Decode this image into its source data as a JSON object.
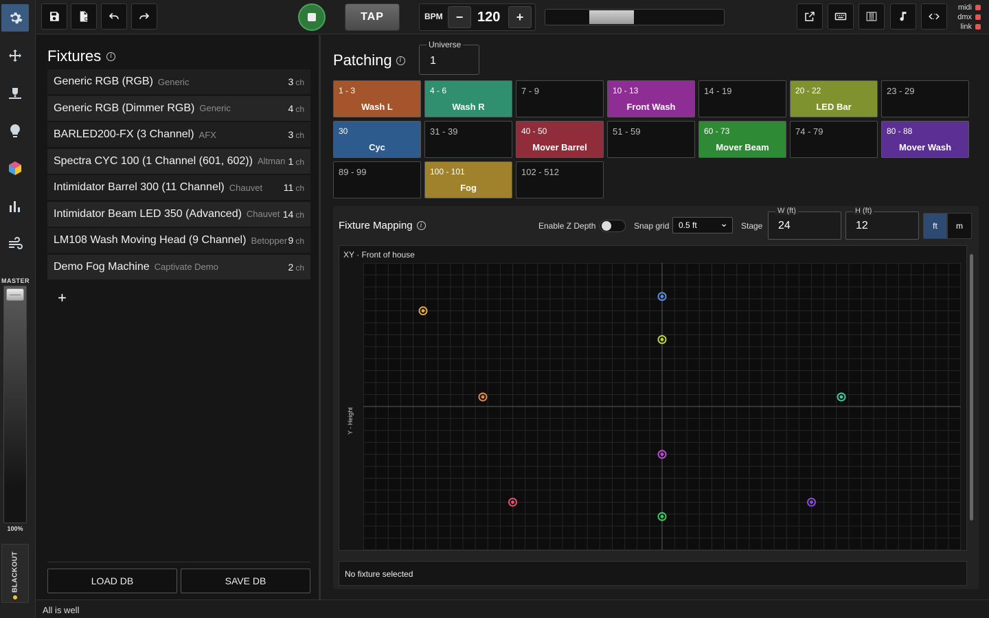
{
  "toolbar": {
    "bpm_label": "BPM",
    "bpm_value": "120",
    "bpm_minus": "−",
    "bpm_plus": "+",
    "tap_label": "TAP",
    "status_lights": [
      {
        "label": "midi",
        "color": "#e05555"
      },
      {
        "label": "dmx",
        "color": "#e05555"
      },
      {
        "label": "link",
        "color": "#e05555"
      }
    ]
  },
  "master": {
    "label": "MASTER",
    "value": "100%",
    "level": 1.0
  },
  "blackout": {
    "label": "BLACKOUT"
  },
  "fixtures": {
    "title": "Fixtures",
    "items": [
      {
        "name": "Generic RGB (RGB)",
        "maker": "Generic",
        "channels": "3",
        "unit": "ch"
      },
      {
        "name": "Generic RGB (Dimmer RGB)",
        "maker": "Generic",
        "channels": "4",
        "unit": "ch"
      },
      {
        "name": "BARLED200-FX (3 Channel)",
        "maker": "AFX",
        "channels": "3",
        "unit": "ch"
      },
      {
        "name": "Spectra CYC 100 (1 Channel (601, 602))",
        "maker": "Altman",
        "channels": "1",
        "unit": "ch"
      },
      {
        "name": "Intimidator Barrel 300 (11 Channel)",
        "maker": "Chauvet",
        "channels": "11",
        "unit": "ch"
      },
      {
        "name": "Intimidator Beam LED 350 (Advanced)",
        "maker": "Chauvet",
        "channels": "14",
        "unit": "ch"
      },
      {
        "name": "LM108 Wash Moving Head (9 Channel)",
        "maker": "Betopper",
        "channels": "9",
        "unit": "ch"
      },
      {
        "name": "Demo Fog Machine",
        "maker": "Captivate Demo",
        "channels": "2",
        "unit": "ch"
      }
    ],
    "add_label": "+",
    "load_db": "LOAD DB",
    "save_db": "SAVE DB"
  },
  "patching": {
    "title": "Patching",
    "universe_label": "Universe",
    "universe_value": "1",
    "tiles": [
      {
        "range": "1 - 3",
        "name": "Wash L",
        "color": "#a4552c"
      },
      {
        "range": "4 - 6",
        "name": "Wash R",
        "color": "#2f8f6e"
      },
      {
        "range": "7 - 9",
        "name": "",
        "color": ""
      },
      {
        "range": "10 - 13",
        "name": "Front Wash",
        "color": "#8e2e94"
      },
      {
        "range": "14 - 19",
        "name": "",
        "color": ""
      },
      {
        "range": "20 - 22",
        "name": "LED Bar",
        "color": "#7e9230"
      },
      {
        "range": "23 - 29",
        "name": "",
        "color": ""
      },
      {
        "range": "30",
        "name": "Cyc",
        "color": "#2e5b8e"
      },
      {
        "range": "31 - 39",
        "name": "",
        "color": ""
      },
      {
        "range": "40 - 50",
        "name": "Mover Barrel",
        "color": "#912c3a"
      },
      {
        "range": "51 - 59",
        "name": "",
        "color": ""
      },
      {
        "range": "60 - 73",
        "name": "Mover Beam",
        "color": "#2f8a35"
      },
      {
        "range": "74 - 79",
        "name": "",
        "color": ""
      },
      {
        "range": "80 - 88",
        "name": "Mover Wash",
        "color": "#5c2f95"
      },
      {
        "range": "89 - 99",
        "name": "",
        "color": ""
      },
      {
        "range": "100 - 101",
        "name": "Fog",
        "color": "#a0822c"
      },
      {
        "range": "102 - 512",
        "name": "",
        "color": ""
      }
    ]
  },
  "mapping": {
    "title": "Fixture Mapping",
    "z_depth_label": "Enable Z Depth",
    "z_depth_enabled": false,
    "snap_label": "Snap grid",
    "snap_value": "0.5 ft",
    "stage_label": "Stage",
    "width_label": "W (ft)",
    "width_value": "24",
    "height_label": "H (ft)",
    "height_value": "12",
    "unit_ft": "ft",
    "unit_m": "m",
    "view_label": "XY · Front of house",
    "y_axis_label": "Y - Height",
    "selection_text": "No fixture selected",
    "points": [
      {
        "x": 2.4,
        "y": 10.0,
        "color": "#e0a840"
      },
      {
        "x": 12.0,
        "y": 10.6,
        "color": "#5a8ee0"
      },
      {
        "x": 12.0,
        "y": 8.8,
        "color": "#b9cf3f"
      },
      {
        "x": 4.8,
        "y": 6.4,
        "color": "#e08a50"
      },
      {
        "x": 19.2,
        "y": 6.4,
        "color": "#3fc8a0"
      },
      {
        "x": 12.0,
        "y": 4.0,
        "color": "#c04ad8"
      },
      {
        "x": 6.0,
        "y": 2.0,
        "color": "#e05070"
      },
      {
        "x": 18.0,
        "y": 2.0,
        "color": "#8a4ad8"
      },
      {
        "x": 12.0,
        "y": 1.4,
        "color": "#3ac860"
      }
    ]
  },
  "footer": {
    "status": "All is well"
  }
}
